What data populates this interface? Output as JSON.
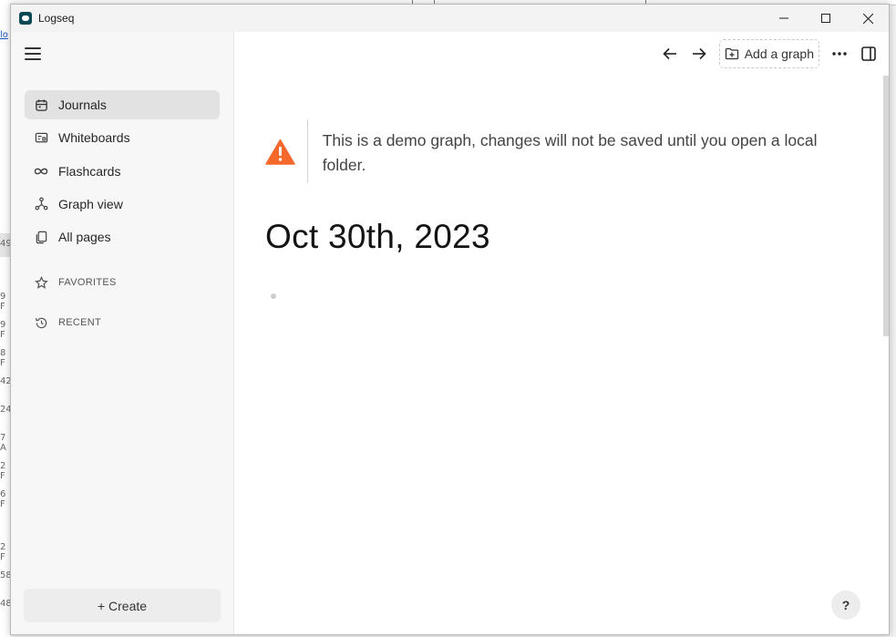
{
  "window": {
    "app_title": "Logseq",
    "controls": [
      "minimize-icon",
      "maximize-icon",
      "close-icon"
    ]
  },
  "sidebar": {
    "menu_icon": "hamburger-icon",
    "items": [
      {
        "label": "Journals",
        "icon": "calendar-icon",
        "active": true
      },
      {
        "label": "Whiteboards",
        "icon": "whiteboard-icon",
        "active": false
      },
      {
        "label": "Flashcards",
        "icon": "infinity-icon",
        "active": false
      },
      {
        "label": "Graph view",
        "icon": "graph-icon",
        "active": false
      },
      {
        "label": "All pages",
        "icon": "pages-icon",
        "active": false
      }
    ],
    "favorites_label": "FAVORITES",
    "recent_label": "RECENT",
    "create_label": "+ Create"
  },
  "toolbar": {
    "back_icon": "arrow-left-icon",
    "forward_icon": "arrow-right-icon",
    "add_graph_label": "Add a graph",
    "more_icon": "more-horizontal-icon",
    "right_sidebar_icon": "sidebar-toggle-icon"
  },
  "notice": {
    "text": "This is a demo graph, changes will not be saved until you open a local folder.",
    "icon": "warning-icon",
    "accent": "#f7682d"
  },
  "journal": {
    "title": "Oct 30th, 2023"
  },
  "help": {
    "label": "?"
  },
  "background": {
    "fragments": [
      "lo",
      "49",
      "9 F",
      "9 F",
      "8 F",
      "42",
      "24",
      "7 A",
      "2 F",
      "6 F",
      "2 F",
      "58",
      "48"
    ]
  }
}
